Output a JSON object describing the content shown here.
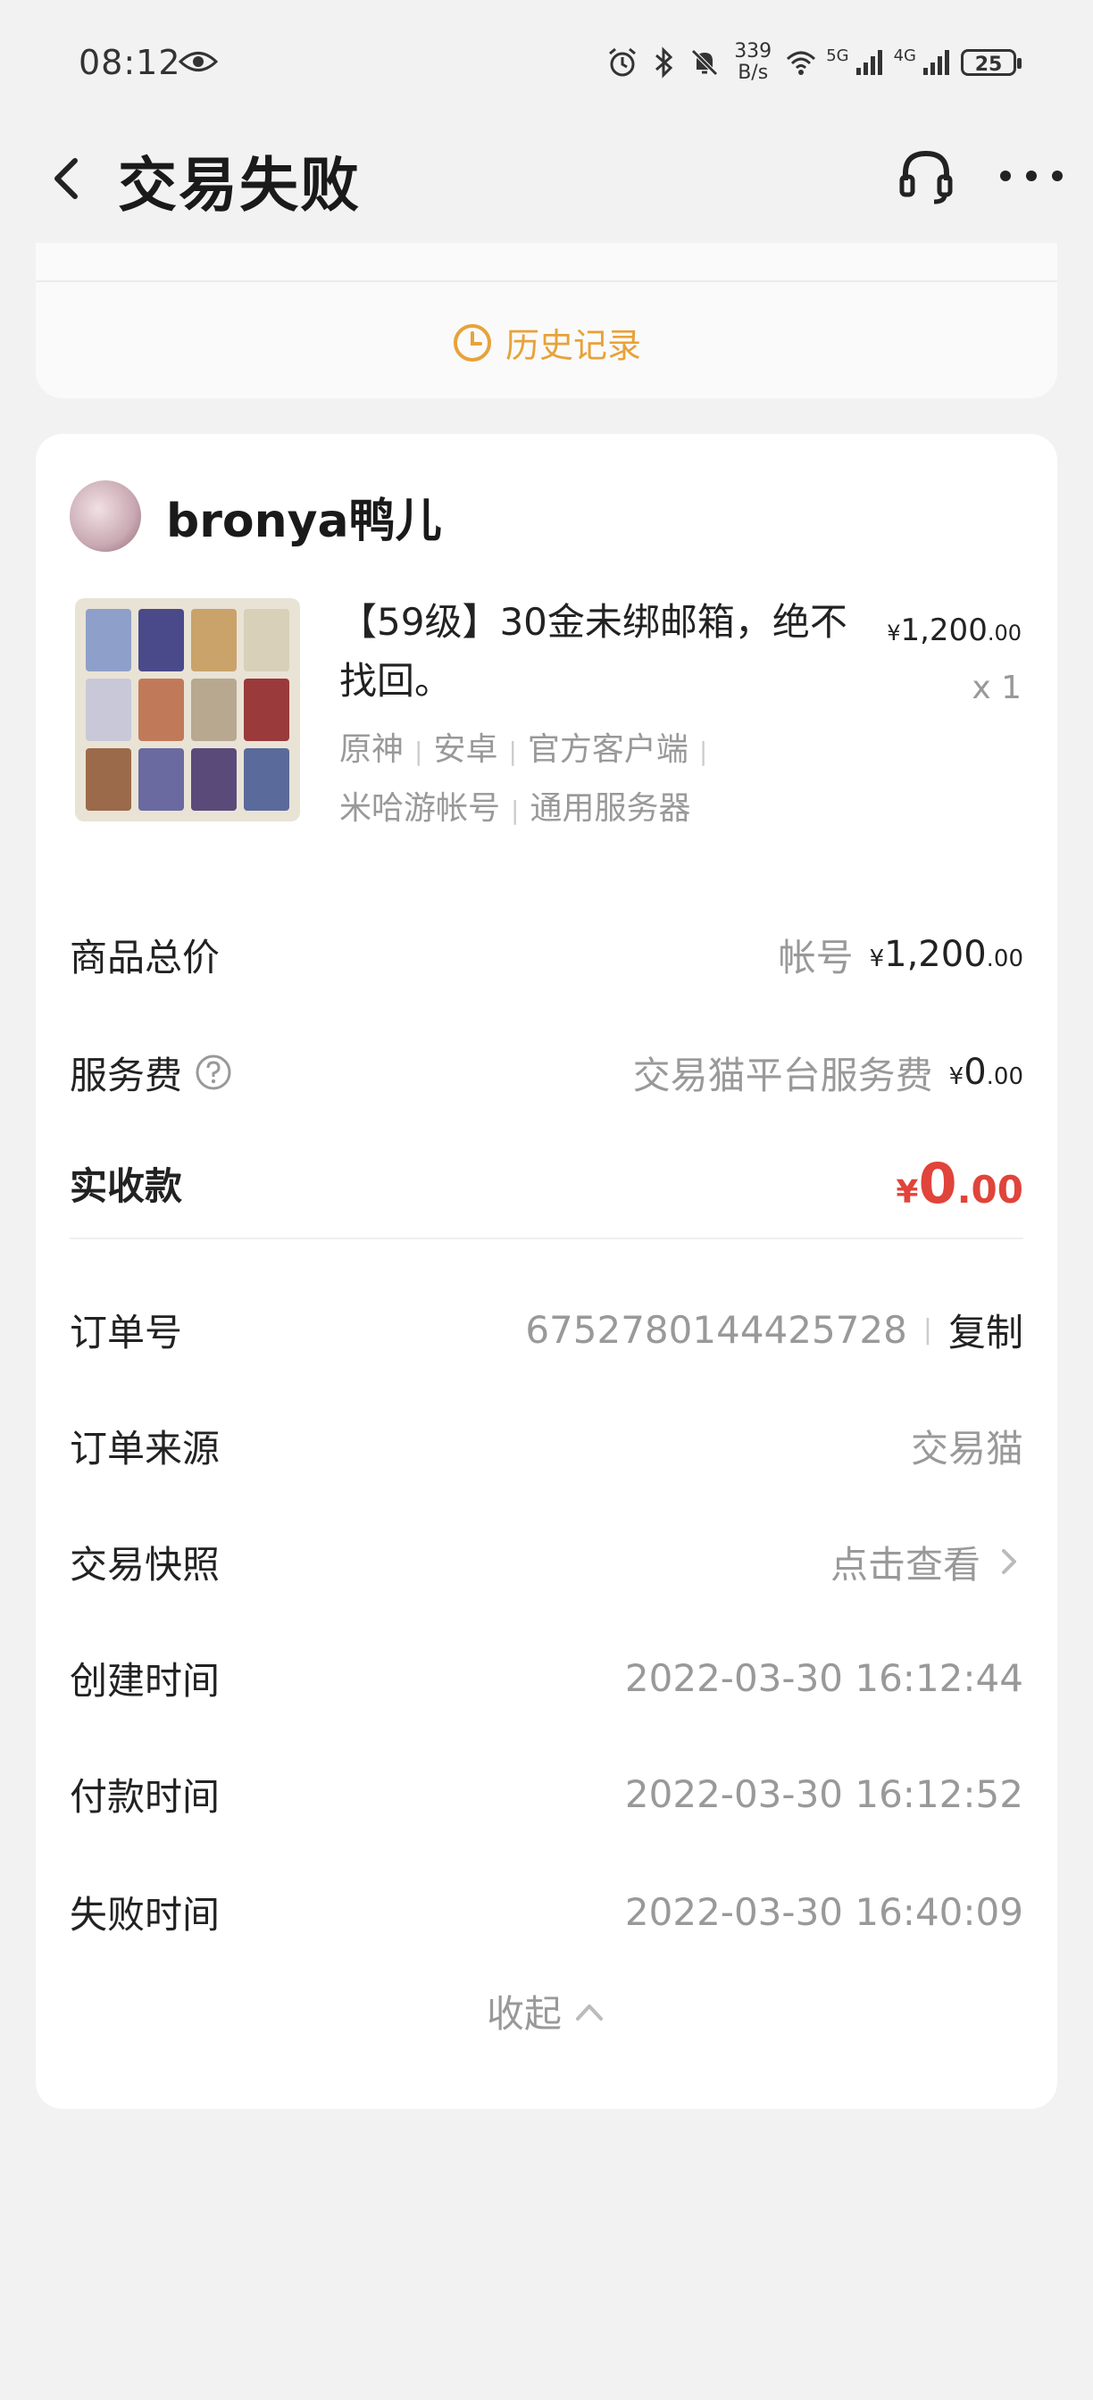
{
  "status_bar": {
    "time": "08:12",
    "speed_value": "339",
    "speed_unit": "B/s",
    "net1": "5G",
    "net2": "4G",
    "battery": "25"
  },
  "header": {
    "title": "交易失败"
  },
  "history": {
    "label": "历史记录"
  },
  "seller": {
    "name": "bronya鸭儿"
  },
  "product": {
    "title": "【59级】30金未绑邮箱，绝不找回。",
    "tags_line1": [
      "原神",
      "安卓",
      "官方客户端"
    ],
    "tags_line2": [
      "米哈游帐号",
      "通用服务器"
    ],
    "price_symbol": "¥",
    "price_int": "1,200",
    "price_dec": ".00",
    "qty": "x 1"
  },
  "summary": {
    "total_label": "商品总价",
    "total_type": "帐号",
    "total_int": "1,200",
    "total_dec": ".00",
    "fee_label": "服务费",
    "fee_desc": "交易猫平台服务费",
    "fee_int": "0",
    "fee_dec": ".00",
    "actual_label": "实收款",
    "actual_int": "0",
    "actual_dec": ".00",
    "currency": "¥"
  },
  "order": {
    "id_label": "订单号",
    "id_value": "6752780144425728",
    "copy_label": "复制",
    "source_label": "订单来源",
    "source_value": "交易猫",
    "snapshot_label": "交易快照",
    "snapshot_value": "点击查看",
    "created_label": "创建时间",
    "created_value": "2022-03-30 16:12:44",
    "paid_label": "付款时间",
    "paid_value": "2022-03-30 16:12:52",
    "failed_label": "失败时间",
    "failed_value": "2022-03-30 16:40:09",
    "collapse_label": "收起"
  },
  "colors": {
    "accent": "#e8a23a",
    "price_red": "#e0443a"
  }
}
